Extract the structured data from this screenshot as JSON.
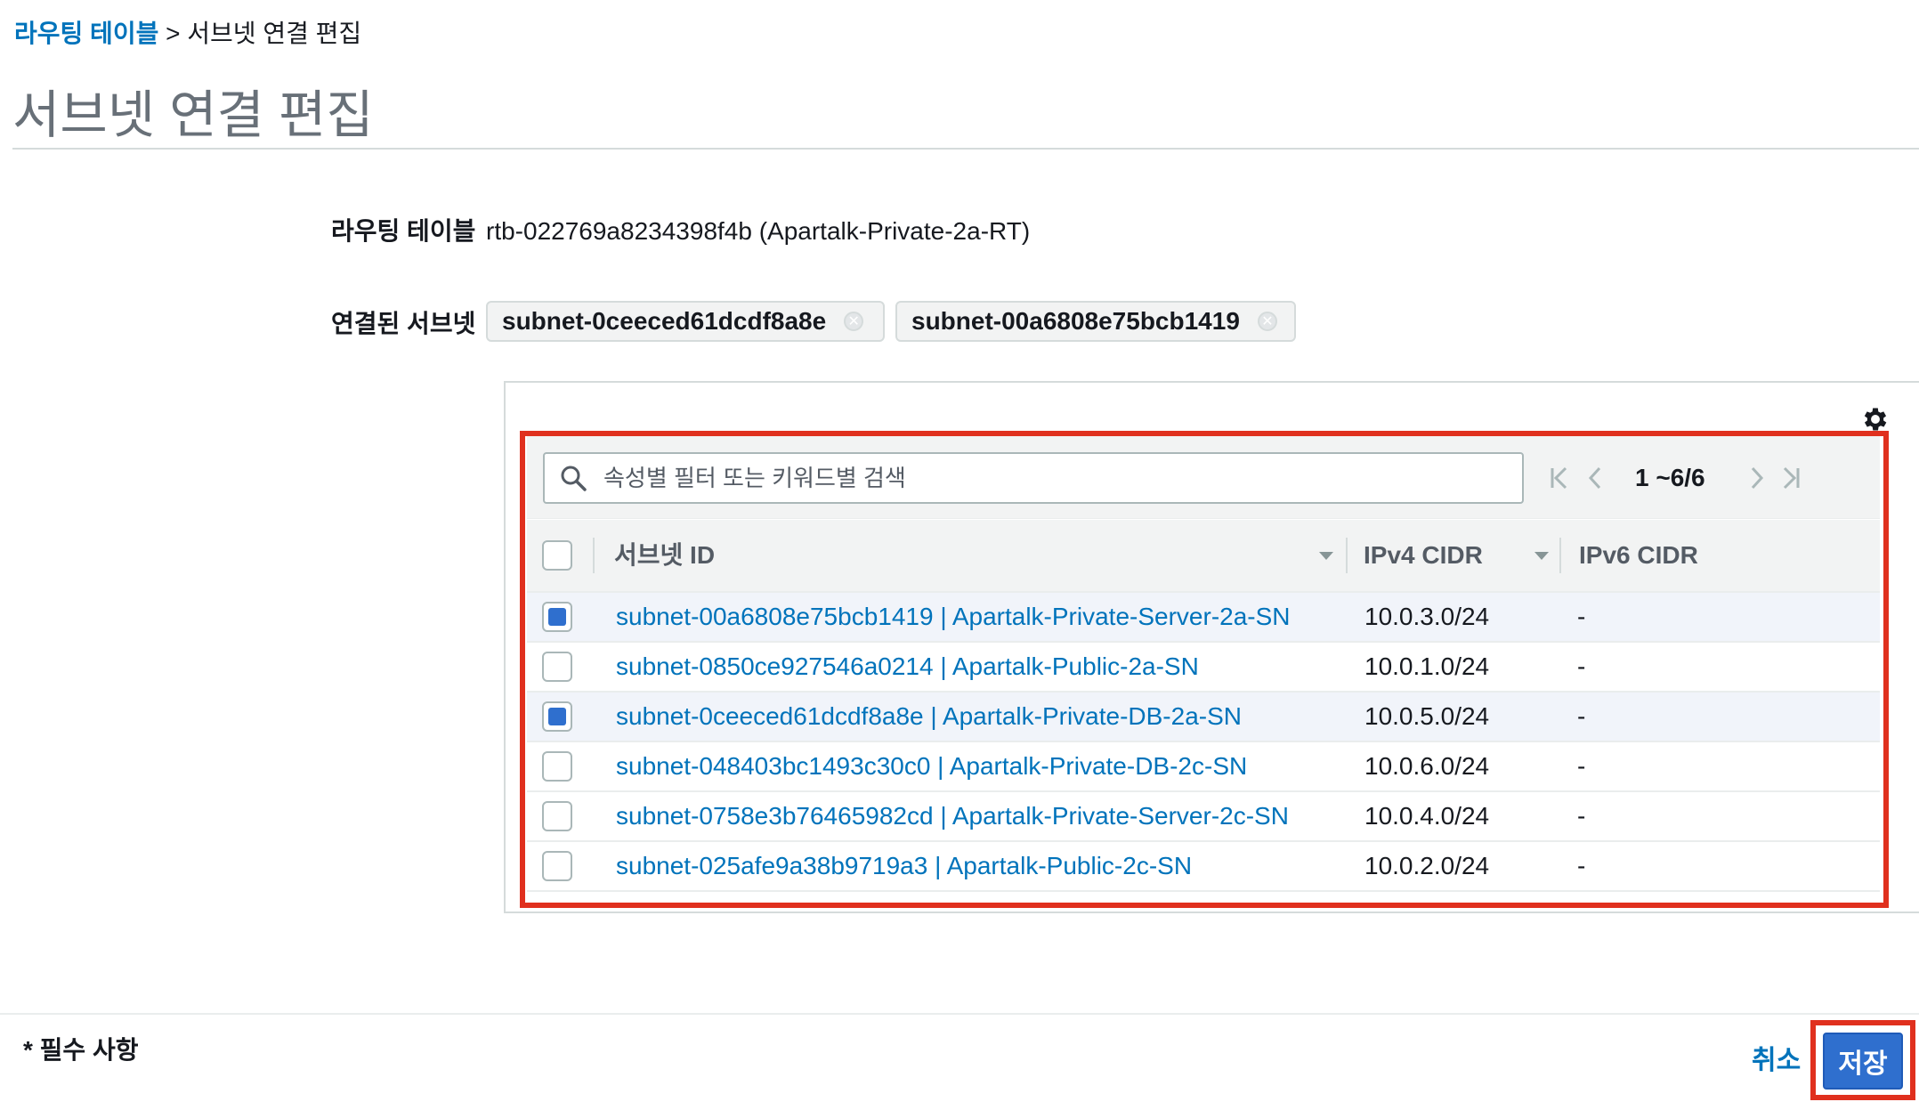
{
  "breadcrumb": {
    "parent": "라우팅 테이블",
    "separator": ">",
    "current": "서브넷 연결 편집"
  },
  "page_title": "서브넷 연결 편집",
  "route_table": {
    "label": "라우팅 테이블",
    "value": "rtb-022769a8234398f4b (Apartalk-Private-2a-RT)"
  },
  "associated_subnets": {
    "label": "연결된 서브넷",
    "tokens": [
      "subnet-0ceeced61dcdf8a8e",
      "subnet-00a6808e75bcb1419"
    ]
  },
  "table": {
    "search_placeholder": "속성별 필터 또는 키워드별 검색",
    "pagination": "1 ~6/6",
    "columns": [
      "서브넷 ID",
      "IPv4 CIDR",
      "IPv6 CIDR"
    ],
    "rows": [
      {
        "subnet": "subnet-00a6808e75bcb1419 | Apartalk-Private-Server-2a-SN",
        "ipv4": "10.0.3.0/24",
        "ipv6": "-",
        "checked": true
      },
      {
        "subnet": "subnet-0850ce927546a0214 | Apartalk-Public-2a-SN",
        "ipv4": "10.0.1.0/24",
        "ipv6": "-",
        "checked": false
      },
      {
        "subnet": "subnet-0ceeced61dcdf8a8e | Apartalk-Private-DB-2a-SN",
        "ipv4": "10.0.5.0/24",
        "ipv6": "-",
        "checked": true
      },
      {
        "subnet": "subnet-048403bc1493c30c0 | Apartalk-Private-DB-2c-SN",
        "ipv4": "10.0.6.0/24",
        "ipv6": "-",
        "checked": false
      },
      {
        "subnet": "subnet-0758e3b76465982cd | Apartalk-Private-Server-2c-SN",
        "ipv4": "10.0.4.0/24",
        "ipv6": "-",
        "checked": false
      },
      {
        "subnet": "subnet-025afe9a38b9719a3 | Apartalk-Public-2c-SN",
        "ipv4": "10.0.2.0/24",
        "ipv6": "-",
        "checked": false
      }
    ]
  },
  "footer": {
    "required_note": "* 필수 사항",
    "cancel_label": "취소",
    "save_label": "저장"
  },
  "colors": {
    "link": "#0073bb",
    "primary_button": "#2f6fce",
    "highlight_border": "#e0301e",
    "selected_row": "#f1f4fa"
  }
}
